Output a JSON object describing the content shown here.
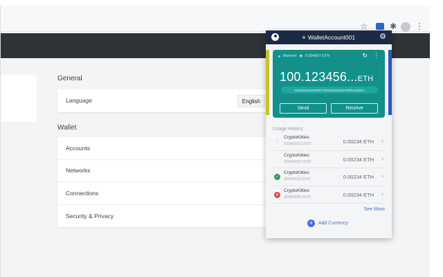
{
  "browser": {
    "toolbar_icons": [
      "star-icon",
      "wallet-extension-icon",
      "puzzle-icon",
      "avatar",
      "more-vert-icon"
    ]
  },
  "settings": {
    "general_title": "General",
    "language_label": "Language",
    "language_value": "English",
    "wallet_title": "Wallet",
    "wallet_items": [
      "Accounts",
      "Networks",
      "Connections",
      "Security & Privacy"
    ]
  },
  "popup": {
    "account_name": "WalletAccount001",
    "network": "Mainnet",
    "network_balance": "0.004567 ETH",
    "balance_value": "100.123456...",
    "balance_unit": "ETH",
    "address": "0x2a1b2c3d4e5f60718293a4b5c6d7e8f9012a3b4c",
    "send_label": "Send",
    "receive_label": "Receive",
    "history_title": "Usage History",
    "history": [
      {
        "name": "CryptoKitties",
        "date": "2019/10/12 15:02",
        "amount": "0.00234 ETH",
        "status": "pending"
      },
      {
        "name": "CryptoKitties",
        "date": "2019/10/12 15:02",
        "amount": "0.00234 ETH",
        "status": "pending"
      },
      {
        "name": "CryptoKitties",
        "date": "2019/10/12 22:02",
        "amount": "0.00234 ETH",
        "status": "success"
      },
      {
        "name": "CryptoKitties",
        "date": "2019/10/09 20:02",
        "amount": "0.00234 ETH",
        "status": "failed"
      }
    ],
    "see_more": "See More",
    "add_currency": "Add Currency",
    "colors": {
      "header": "#1c2a44",
      "card": "#13908a",
      "accent": "#4a6fcb",
      "success": "#2e9b56",
      "failed": "#e04646",
      "pending": "#d7c02a"
    }
  }
}
